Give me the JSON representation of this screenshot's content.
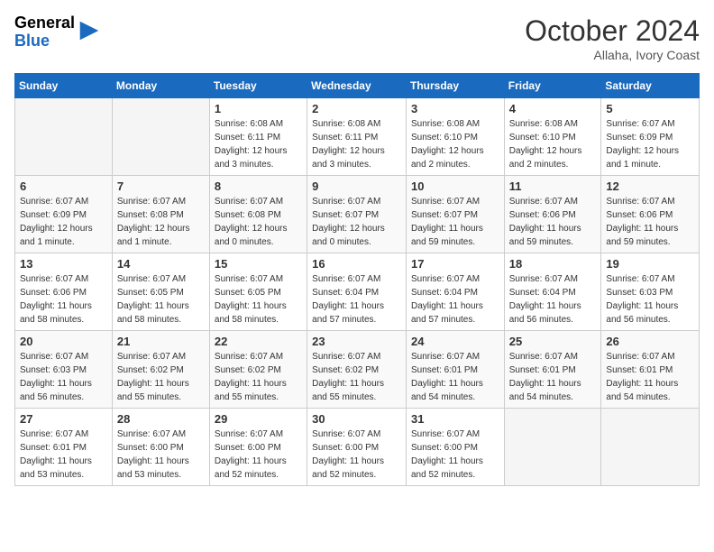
{
  "header": {
    "logo": {
      "general": "General",
      "blue": "Blue",
      "arrow_unicode": "▶"
    },
    "month_title": "October 2024",
    "location": "Allaha, Ivory Coast"
  },
  "weekdays": [
    "Sunday",
    "Monday",
    "Tuesday",
    "Wednesday",
    "Thursday",
    "Friday",
    "Saturday"
  ],
  "weeks": [
    [
      {
        "day": "",
        "info": ""
      },
      {
        "day": "",
        "info": ""
      },
      {
        "day": "1",
        "info": "Sunrise: 6:08 AM\nSunset: 6:11 PM\nDaylight: 12 hours\nand 3 minutes."
      },
      {
        "day": "2",
        "info": "Sunrise: 6:08 AM\nSunset: 6:11 PM\nDaylight: 12 hours\nand 3 minutes."
      },
      {
        "day": "3",
        "info": "Sunrise: 6:08 AM\nSunset: 6:10 PM\nDaylight: 12 hours\nand 2 minutes."
      },
      {
        "day": "4",
        "info": "Sunrise: 6:08 AM\nSunset: 6:10 PM\nDaylight: 12 hours\nand 2 minutes."
      },
      {
        "day": "5",
        "info": "Sunrise: 6:07 AM\nSunset: 6:09 PM\nDaylight: 12 hours\nand 1 minute."
      }
    ],
    [
      {
        "day": "6",
        "info": "Sunrise: 6:07 AM\nSunset: 6:09 PM\nDaylight: 12 hours\nand 1 minute."
      },
      {
        "day": "7",
        "info": "Sunrise: 6:07 AM\nSunset: 6:08 PM\nDaylight: 12 hours\nand 1 minute."
      },
      {
        "day": "8",
        "info": "Sunrise: 6:07 AM\nSunset: 6:08 PM\nDaylight: 12 hours\nand 0 minutes."
      },
      {
        "day": "9",
        "info": "Sunrise: 6:07 AM\nSunset: 6:07 PM\nDaylight: 12 hours\nand 0 minutes."
      },
      {
        "day": "10",
        "info": "Sunrise: 6:07 AM\nSunset: 6:07 PM\nDaylight: 11 hours\nand 59 minutes."
      },
      {
        "day": "11",
        "info": "Sunrise: 6:07 AM\nSunset: 6:06 PM\nDaylight: 11 hours\nand 59 minutes."
      },
      {
        "day": "12",
        "info": "Sunrise: 6:07 AM\nSunset: 6:06 PM\nDaylight: 11 hours\nand 59 minutes."
      }
    ],
    [
      {
        "day": "13",
        "info": "Sunrise: 6:07 AM\nSunset: 6:06 PM\nDaylight: 11 hours\nand 58 minutes."
      },
      {
        "day": "14",
        "info": "Sunrise: 6:07 AM\nSunset: 6:05 PM\nDaylight: 11 hours\nand 58 minutes."
      },
      {
        "day": "15",
        "info": "Sunrise: 6:07 AM\nSunset: 6:05 PM\nDaylight: 11 hours\nand 58 minutes."
      },
      {
        "day": "16",
        "info": "Sunrise: 6:07 AM\nSunset: 6:04 PM\nDaylight: 11 hours\nand 57 minutes."
      },
      {
        "day": "17",
        "info": "Sunrise: 6:07 AM\nSunset: 6:04 PM\nDaylight: 11 hours\nand 57 minutes."
      },
      {
        "day": "18",
        "info": "Sunrise: 6:07 AM\nSunset: 6:04 PM\nDaylight: 11 hours\nand 56 minutes."
      },
      {
        "day": "19",
        "info": "Sunrise: 6:07 AM\nSunset: 6:03 PM\nDaylight: 11 hours\nand 56 minutes."
      }
    ],
    [
      {
        "day": "20",
        "info": "Sunrise: 6:07 AM\nSunset: 6:03 PM\nDaylight: 11 hours\nand 56 minutes."
      },
      {
        "day": "21",
        "info": "Sunrise: 6:07 AM\nSunset: 6:02 PM\nDaylight: 11 hours\nand 55 minutes."
      },
      {
        "day": "22",
        "info": "Sunrise: 6:07 AM\nSunset: 6:02 PM\nDaylight: 11 hours\nand 55 minutes."
      },
      {
        "day": "23",
        "info": "Sunrise: 6:07 AM\nSunset: 6:02 PM\nDaylight: 11 hours\nand 55 minutes."
      },
      {
        "day": "24",
        "info": "Sunrise: 6:07 AM\nSunset: 6:01 PM\nDaylight: 11 hours\nand 54 minutes."
      },
      {
        "day": "25",
        "info": "Sunrise: 6:07 AM\nSunset: 6:01 PM\nDaylight: 11 hours\nand 54 minutes."
      },
      {
        "day": "26",
        "info": "Sunrise: 6:07 AM\nSunset: 6:01 PM\nDaylight: 11 hours\nand 54 minutes."
      }
    ],
    [
      {
        "day": "27",
        "info": "Sunrise: 6:07 AM\nSunset: 6:01 PM\nDaylight: 11 hours\nand 53 minutes."
      },
      {
        "day": "28",
        "info": "Sunrise: 6:07 AM\nSunset: 6:00 PM\nDaylight: 11 hours\nand 53 minutes."
      },
      {
        "day": "29",
        "info": "Sunrise: 6:07 AM\nSunset: 6:00 PM\nDaylight: 11 hours\nand 52 minutes."
      },
      {
        "day": "30",
        "info": "Sunrise: 6:07 AM\nSunset: 6:00 PM\nDaylight: 11 hours\nand 52 minutes."
      },
      {
        "day": "31",
        "info": "Sunrise: 6:07 AM\nSunset: 6:00 PM\nDaylight: 11 hours\nand 52 minutes."
      },
      {
        "day": "",
        "info": ""
      },
      {
        "day": "",
        "info": ""
      }
    ]
  ]
}
